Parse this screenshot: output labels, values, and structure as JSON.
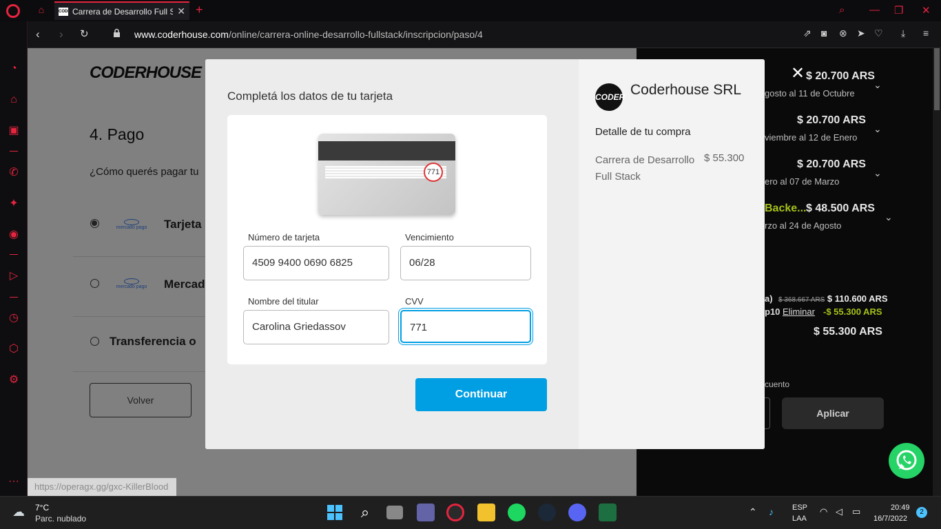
{
  "browser": {
    "tab_title": "Carrera de Desarrollo Full S",
    "favicon_text": "CODER",
    "url_host": "www.coderhouse.com",
    "url_path": "/online/carrera-online-desarrollo-fullstack/inscripcion/paso/4",
    "status_url": "https://operagx.gg/gxc-KillerBlood",
    "accent": "#e5243f"
  },
  "page": {
    "logo": "CODERHOUSE",
    "step_title": "4. Pago",
    "pay_question": "¿Cómo querés pagar tu",
    "options": [
      {
        "label": "Tarjeta",
        "selected": true,
        "logo": "mercado pago"
      },
      {
        "label": "Mercado",
        "selected": false,
        "logo": "mercado pago"
      },
      {
        "label": "Transferencia o",
        "selected": false
      }
    ],
    "back_label": "Volver"
  },
  "summary": {
    "items": [
      {
        "price": "$ 20.700 ARS",
        "dates": "gosto al 11 de Octubre"
      },
      {
        "price": "$ 20.700 ARS",
        "dates": "viembre al 12 de Enero"
      },
      {
        "price": "$ 20.700 ARS",
        "dates": "ero al 07 de Marzo"
      },
      {
        "name": "Backe...",
        "price": "$ 48.500 ARS",
        "dates": "rzo al 24 de Agosto"
      }
    ],
    "subtotal_prefix": "a)",
    "subtotal_strike": "$ 368.667 ARS",
    "subtotal": "$ 110.600 ARS",
    "coupon_prefix": "p10",
    "coupon_remove": "Eliminar",
    "discount": "-$ 55.300 ARS",
    "total": "$ 55.300 ARS",
    "discount_label": "cuento",
    "apply_label": "Aplicar"
  },
  "modal": {
    "heading": "Completá los datos de tu tarjeta",
    "card_cvv": "771",
    "fields": {
      "number_label": "Número de tarjeta",
      "number_value": "4509 9400 0690 6825",
      "expiry_label": "Vencimiento",
      "expiry_value": "06/28",
      "holder_label": "Nombre del titular",
      "holder_value": "Carolina Griedassov",
      "cvv_label": "CVV",
      "cvv_value": "771"
    },
    "continue_label": "Continuar",
    "company_logo_text": "CODER",
    "company_name": "Coderhouse SRL",
    "detail_heading": "Detalle de tu compra",
    "item_name": "Carrera de Desarrollo Full Stack",
    "item_price": "$ 55.300",
    "close_icon": "close-icon"
  },
  "taskbar": {
    "temperature": "7°C",
    "condition": "Parc. nublado",
    "lang": "ESP",
    "layout": "LAA",
    "time": "20:49",
    "date": "16/7/2022",
    "notifications": "2"
  }
}
